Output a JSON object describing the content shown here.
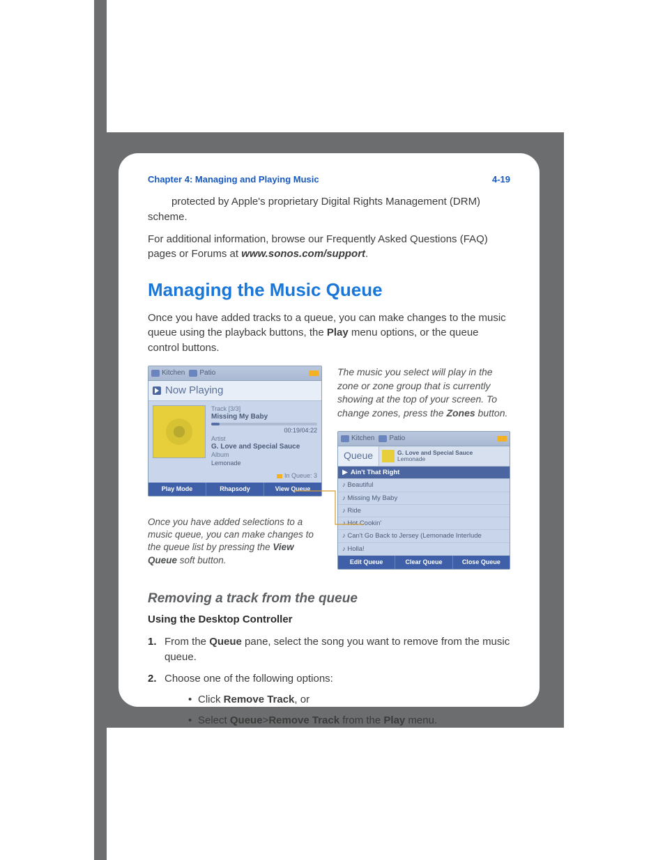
{
  "header": {
    "chapter": "Chapter 4:  Managing and Playing Music",
    "pageno": "4-19"
  },
  "intro": {
    "line1": "protected by Apple's proprietary Digital Rights Management (DRM) scheme.",
    "line2a": "For additional information, browse our Frequently Asked Questions (FAQ) pages or Forums at ",
    "support_url": "www.sonos.com/support",
    "line2b": "."
  },
  "h1": "Managing the Music Queue",
  "p1a": "Once you have added tracks to a queue, you can make changes to the music queue using the playback buttons, the ",
  "p1_bold": "Play",
  "p1b": " menu options, or the queue control buttons.",
  "sidecopy": {
    "a": "The music you select will play in the zone or zone group that is currently showing at the top of your screen. To change zones, press the ",
    "bold": "Zones",
    "b": " button."
  },
  "caption": {
    "a": "Once you have added selections to a music queue, you can make changes to the queue list by pressing the ",
    "bold": "View Queue",
    "b": " soft button."
  },
  "nowplaying": {
    "zone1": "Kitchen",
    "zone2": "Patio",
    "heading": "Now Playing",
    "tracknum": "Track [3/3]",
    "title": "Missing My Baby",
    "time": "00:19/04:22",
    "artist_lbl": "Artist",
    "artist": "G. Love and Special Sauce",
    "album_lbl": "Album",
    "album": "Lemonade",
    "inqueue": "In Queue: 3",
    "soft": {
      "a": "Play Mode",
      "b": "Rhapsody",
      "c": "View Queue"
    }
  },
  "queue": {
    "zone1": "Kitchen",
    "zone2": "Patio",
    "heading": "Queue",
    "side_artist": "G. Love and Special Sauce",
    "side_album": "Lemonade",
    "tracks": [
      "Ain't That Right",
      "Beautiful",
      "Missing My Baby",
      "Ride",
      "Hot Cookin'",
      "Can't Go Back to Jersey (Lemonade Interlude",
      "Holla!"
    ],
    "soft": {
      "a": "Edit Queue",
      "b": "Clear Queue",
      "c": "Close Queue"
    }
  },
  "h2": "Removing a track from the queue",
  "h3": "Using the Desktop Controller",
  "steps": {
    "s1a": "From the ",
    "s1_bold": "Queue",
    "s1b": " pane, select the song you want to remove from the music queue.",
    "s2": "Choose one of the following options:",
    "b1a": "Click ",
    "b1_bold": "Remove Track",
    "b1b": ", or",
    "b2a": "Select ",
    "b2_bold1": "Queue",
    "b2_gt": ">",
    "b2_bold2": "Remove Track",
    "b2b": " from the ",
    "b2_bold3": "Play",
    "b2c": " menu."
  }
}
